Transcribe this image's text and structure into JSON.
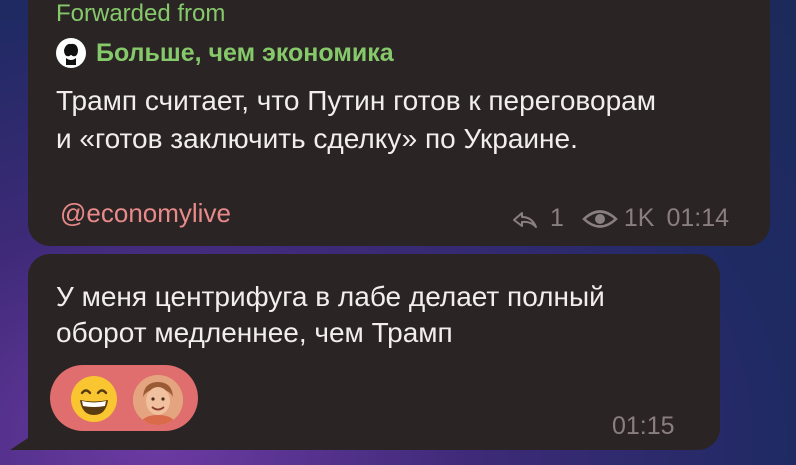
{
  "message1": {
    "forward_label": "Forwarded from",
    "channel_name": "Больше, чем экономика",
    "text_line1": "Трамп считает, что Путин готов к переговорам",
    "text_line2": "и «готов заключить сделку» по Украине.",
    "link": "@economylive",
    "replies": "1",
    "views": "1K",
    "time": "01:14",
    "icons": [
      "reply-icon",
      "eye-icon"
    ]
  },
  "message2": {
    "text_line1": "У меня центрифуга в лабе делает полный",
    "text_line2": "оборот медленнее, чем Трамп",
    "time": "01:15",
    "reaction_emoji": "grinning-face-emoji"
  },
  "colors": {
    "bubble": "#2b2424",
    "forward_green": "#85c96b",
    "link": "#e88a8a",
    "reaction_bg": "#e06e6e",
    "meta": "#8a7f80"
  }
}
